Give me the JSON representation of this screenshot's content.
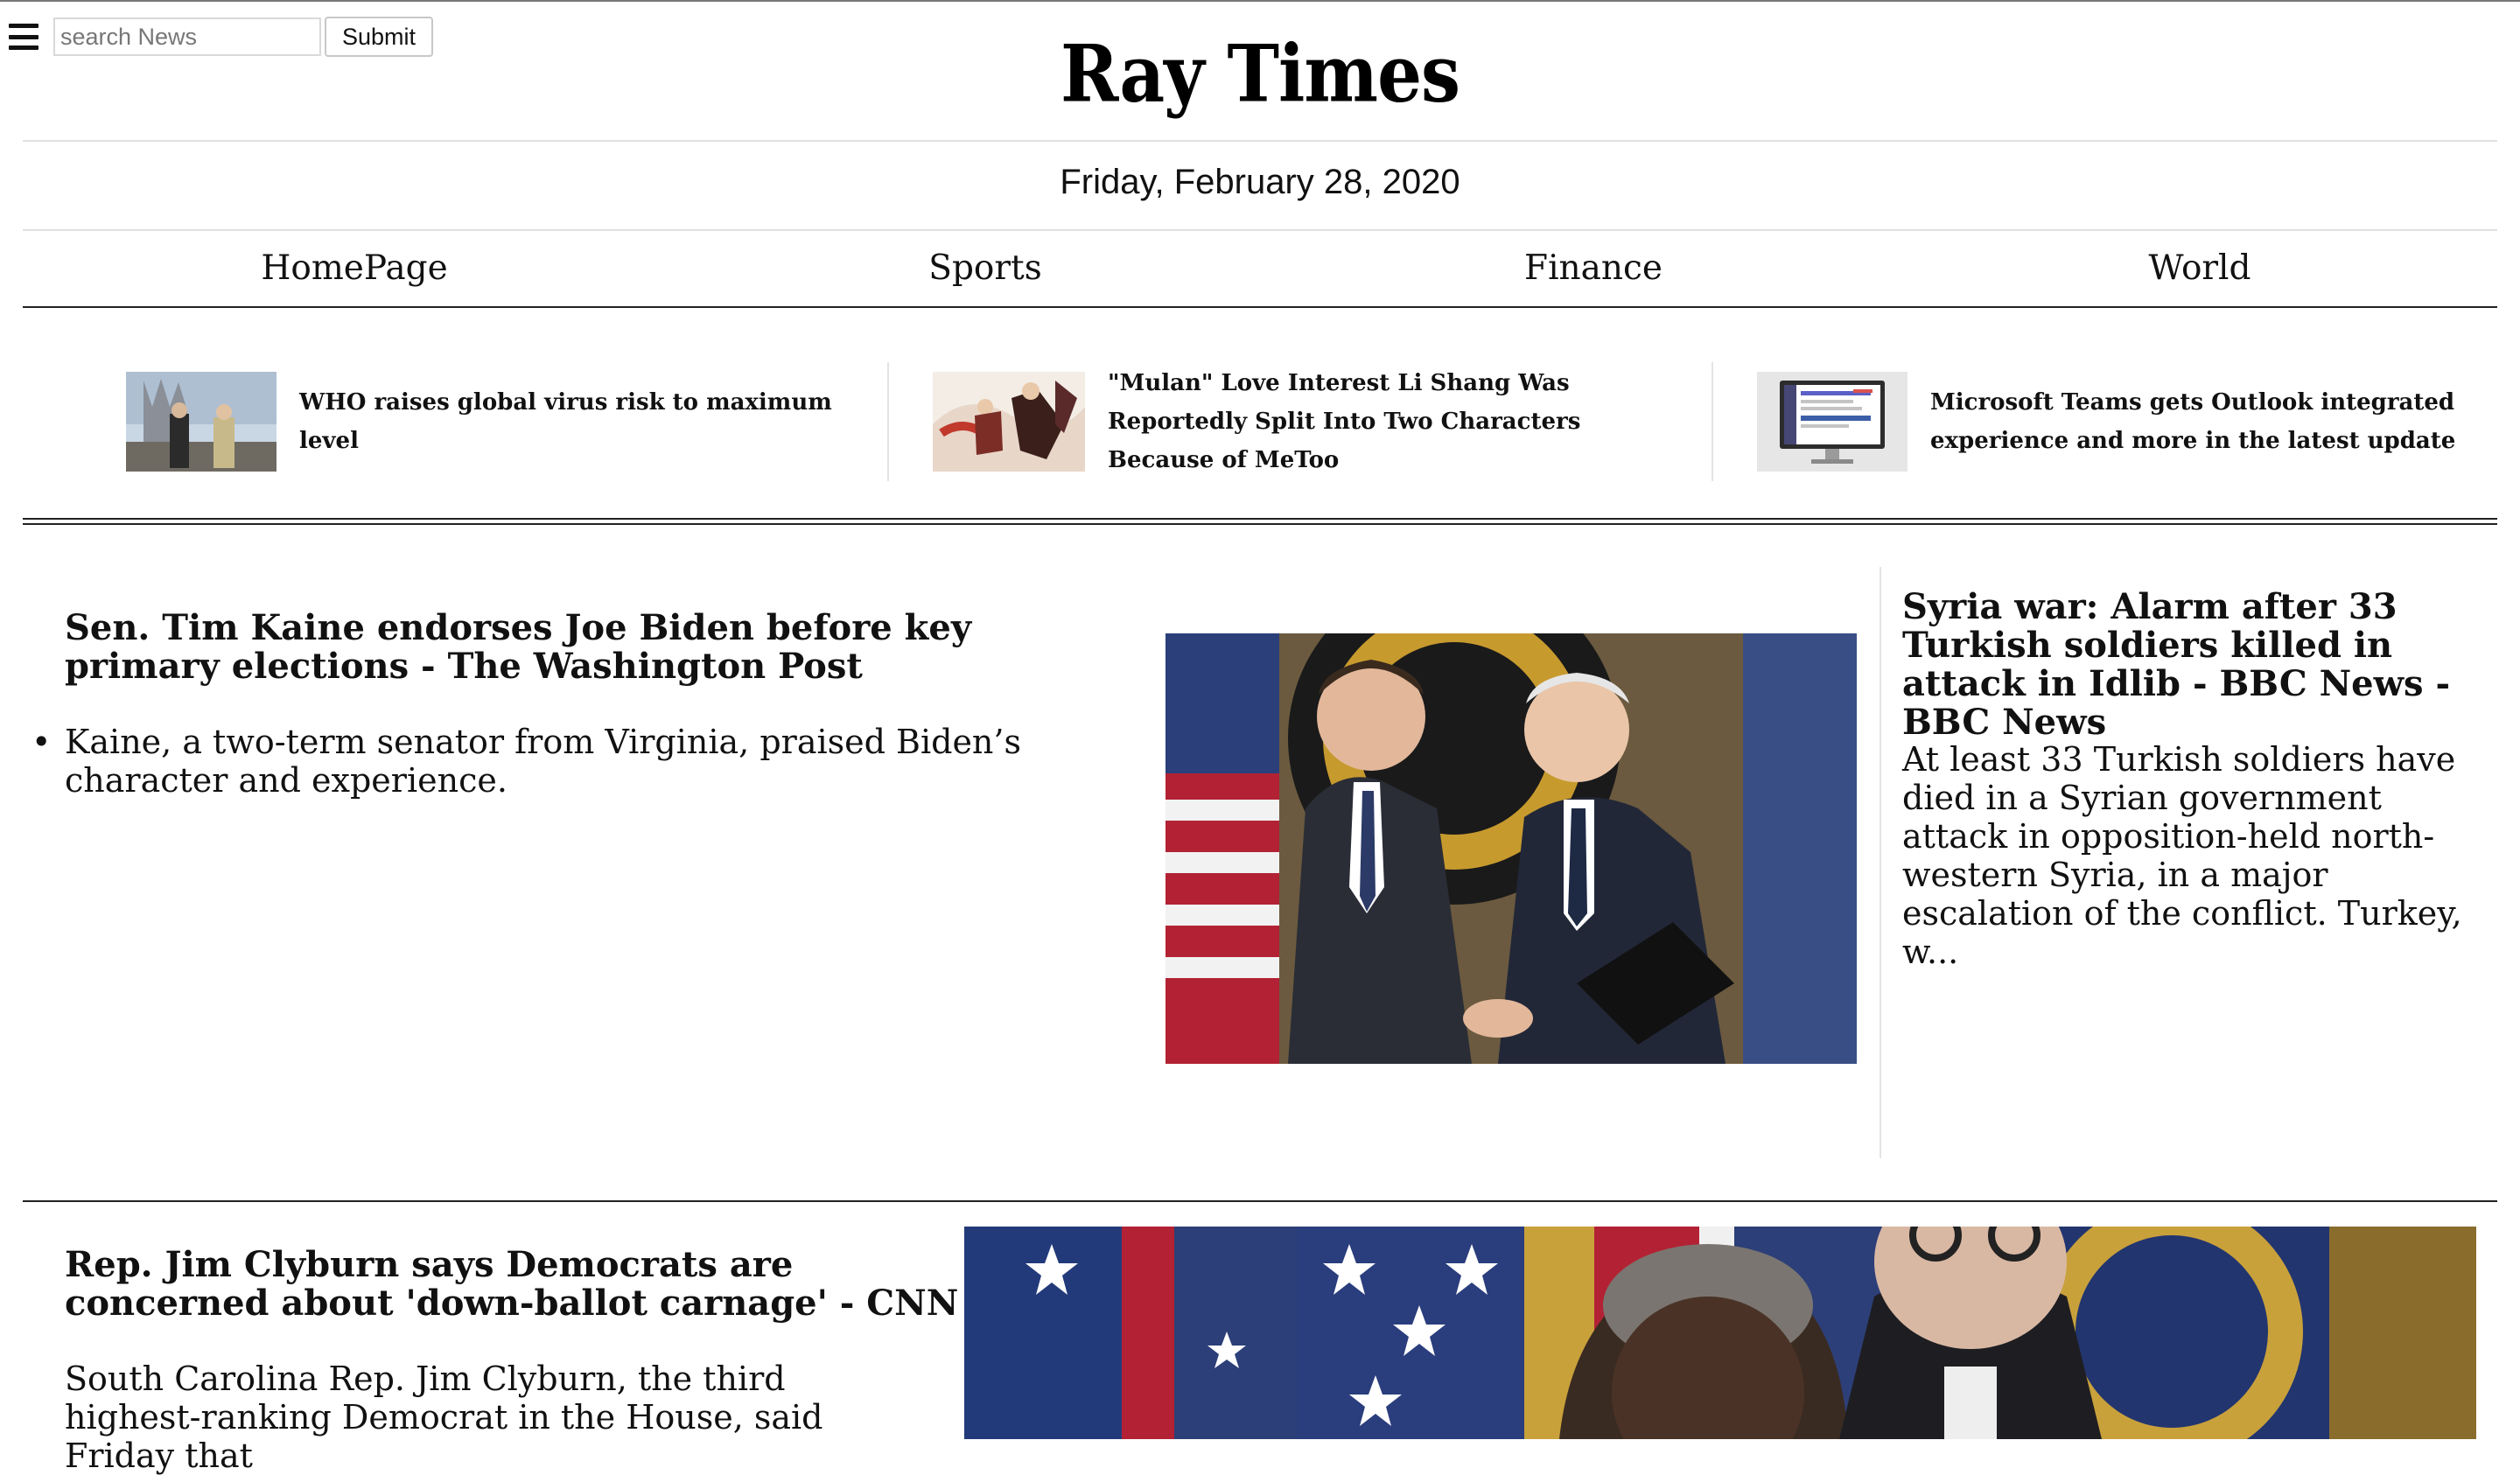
{
  "search": {
    "placeholder": "search News",
    "submit_label": "Submit"
  },
  "masthead": {
    "logo_text": "Ray Times",
    "date": "Friday, February 28, 2020"
  },
  "nav": [
    {
      "label": "HomePage"
    },
    {
      "label": "Sports"
    },
    {
      "label": "Finance"
    },
    {
      "label": "World"
    }
  ],
  "top_stories": [
    {
      "headline": "WHO raises global virus risk to maximum level",
      "image": "street-scene-thumbnail"
    },
    {
      "headline": "\"Mulan\" Love Interest Li Shang Was Reportedly Split Into Two Characters Because of MeToo",
      "image": "animated-characters-thumbnail"
    },
    {
      "headline": "Microsoft Teams gets Outlook integrated experience and more in the latest update",
      "image": "computer-monitor-thumbnail"
    }
  ],
  "lead_story": {
    "headline": "Sen. Tim Kaine endorses Joe Biden before key primary elections - The Washington Post",
    "bullet": "Kaine, a two-term senator from Virginia, praised Biden’s character and experience.",
    "image": "handshake-photo"
  },
  "side_story": {
    "headline": "Syria war: Alarm after 33 Turkish soldiers killed in attack in Idlib - BBC News - BBC News",
    "summary": "At least 33 Turkish soldiers have died in a Syrian government attack in opposition-held north-western Syria, in a major escalation of the conflict. Turkey, w..."
  },
  "second_story": {
    "headline": "Rep. Jim Clyburn says Democrats are concerned about 'down-ballot carnage' - CNN",
    "summary": "South Carolina Rep. Jim Clyburn, the third highest-ranking Democrat in the House, said Friday that",
    "image": "press-conference-photo"
  },
  "colors": {
    "text": "#111111",
    "rule": "#222222",
    "light_rule": "#e1e1e1"
  }
}
